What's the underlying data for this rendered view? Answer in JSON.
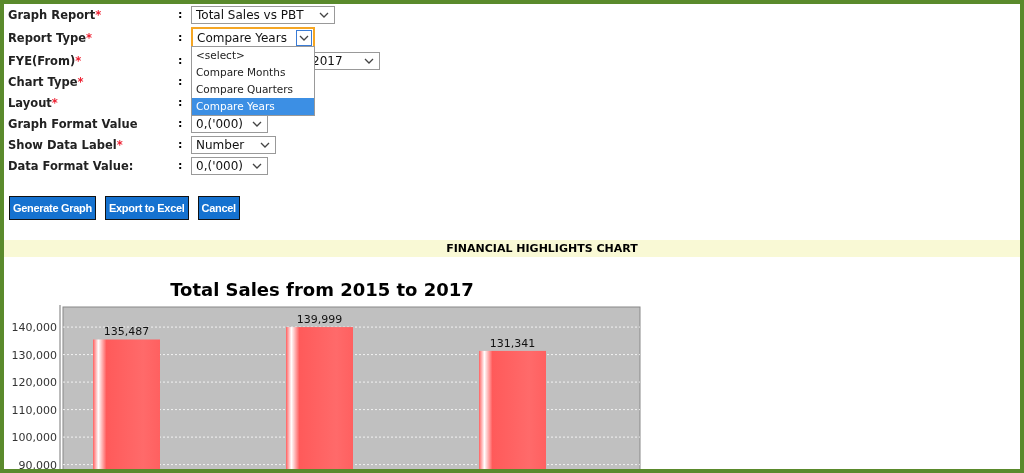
{
  "form": {
    "rows": [
      {
        "label": "Graph Report",
        "asterisk": "*",
        "separator": ":",
        "field": {
          "value": "Total Sales vs PBT"
        }
      },
      {
        "label": "Report Type",
        "asterisk": "*",
        "separator": ":",
        "field": {
          "value": "Compare Years",
          "open": true,
          "options": [
            {
              "label": "<select>",
              "selected": false
            },
            {
              "label": "Compare Months",
              "selected": false
            },
            {
              "label": "Compare Quarters",
              "selected": false
            },
            {
              "label": "Compare Years",
              "selected": true
            }
          ]
        }
      },
      {
        "label": "FYE(From)",
        "asterisk": "*",
        "separator": ":",
        "field": {
          "value": "2017"
        }
      },
      {
        "label": "Chart Type",
        "asterisk": "*",
        "separator": ":"
      },
      {
        "label": "Layout",
        "asterisk": "*",
        "separator": ":"
      },
      {
        "label": "Graph Format Value",
        "separator": ":",
        "field": {
          "value": "0,('000)"
        }
      },
      {
        "label": "Show Data Label",
        "asterisk": "*",
        "separator": ":",
        "field": {
          "value": "Number"
        }
      },
      {
        "label": "Data Format Value:",
        "separator": ":",
        "field": {
          "value": "0,('000)"
        }
      }
    ]
  },
  "buttons": [
    "Generate Graph",
    "Export to Excel",
    "Cancel"
  ],
  "section_header": "FINANCIAL HIGHLIGHTS CHART",
  "chart": {
    "chart_data": {
      "type": "bar",
      "title": "Total Sales from 2015 to 2017",
      "values": [
        135487,
        139999,
        131341
      ],
      "ylim": [
        89500,
        147300
      ],
      "yticks": [
        {
          "value": 90000,
          "label": "90,000"
        },
        {
          "value": 100000,
          "label": "100,000"
        },
        {
          "value": 110000,
          "label": "110,000"
        },
        {
          "value": 120000,
          "label": "120,000"
        },
        {
          "value": 130000,
          "label": "130,000"
        },
        {
          "value": 140000,
          "label": "140,000"
        }
      ],
      "grid": true,
      "value_labels": [
        "135,487",
        "139,999",
        "131,341"
      ]
    }
  }
}
